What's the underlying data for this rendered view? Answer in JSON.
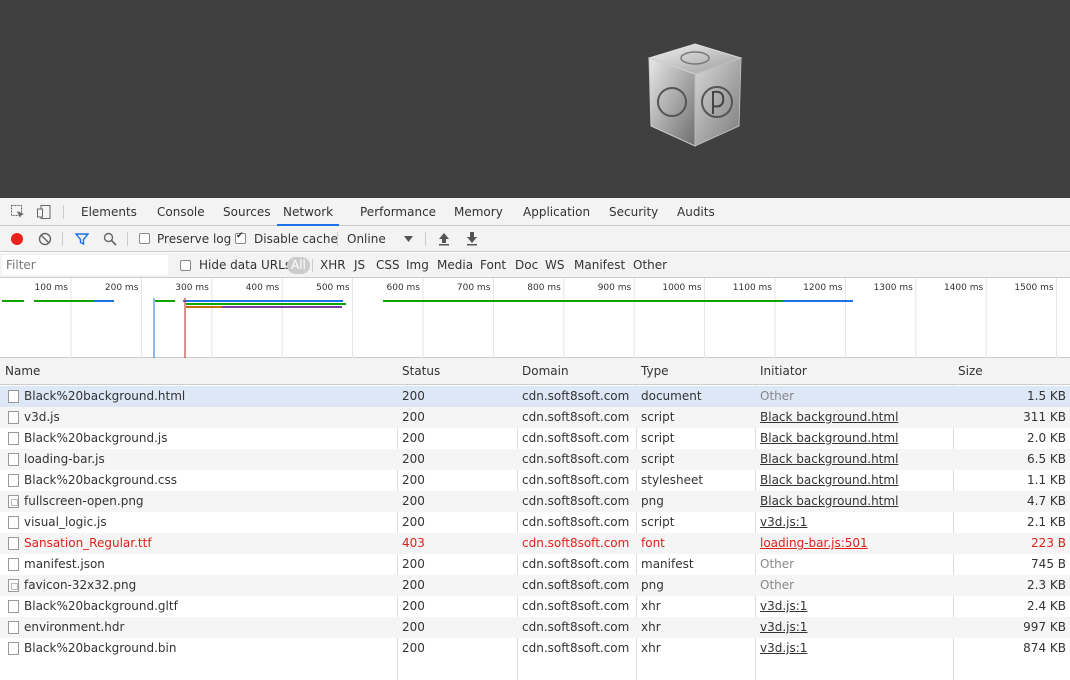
{
  "tabs": [
    "Elements",
    "Console",
    "Sources",
    "Network",
    "Performance",
    "Memory",
    "Application",
    "Security",
    "Audits"
  ],
  "active_tab": "Network",
  "toolbar": {
    "preserve_log": "Preserve log",
    "disable_cache": "Disable cache",
    "throttle": "Online"
  },
  "filterbar": {
    "placeholder": "Filter",
    "hide_data_urls": "Hide data URLs",
    "types": [
      "All",
      "XHR",
      "JS",
      "CSS",
      "Img",
      "Media",
      "Font",
      "Doc",
      "WS",
      "Manifest",
      "Other"
    ]
  },
  "overview": {
    "ticks": [
      "100 ms",
      "200 ms",
      "300 ms",
      "400 ms",
      "500 ms",
      "600 ms",
      "700 ms",
      "800 ms",
      "900 ms",
      "1000 ms",
      "1100 ms",
      "1200 ms",
      "1300 ms",
      "1400 ms",
      "1500 ms"
    ]
  },
  "columns": {
    "name": "Name",
    "status": "Status",
    "domain": "Domain",
    "type": "Type",
    "initiator": "Initiator",
    "size": "Size"
  },
  "rows": [
    {
      "name": "Black%20background.html",
      "status": "200",
      "domain": "cdn.soft8soft.com",
      "type": "document",
      "initiator": "Other",
      "size": "1.5 KB"
    },
    {
      "name": "v3d.js",
      "status": "200",
      "domain": "cdn.soft8soft.com",
      "type": "script",
      "initiator": "Black background.html",
      "size": "311 KB"
    },
    {
      "name": "Black%20background.js",
      "status": "200",
      "domain": "cdn.soft8soft.com",
      "type": "script",
      "initiator": "Black background.html",
      "size": "2.0 KB"
    },
    {
      "name": "loading-bar.js",
      "status": "200",
      "domain": "cdn.soft8soft.com",
      "type": "script",
      "initiator": "Black background.html",
      "size": "6.5 KB"
    },
    {
      "name": "Black%20background.css",
      "status": "200",
      "domain": "cdn.soft8soft.com",
      "type": "stylesheet",
      "initiator": "Black background.html",
      "size": "1.1 KB"
    },
    {
      "name": "fullscreen-open.png",
      "status": "200",
      "domain": "cdn.soft8soft.com",
      "type": "png",
      "initiator": "Black background.html",
      "size": "4.7 KB"
    },
    {
      "name": "visual_logic.js",
      "status": "200",
      "domain": "cdn.soft8soft.com",
      "type": "script",
      "initiator": "v3d.js:1",
      "size": "2.1 KB"
    },
    {
      "name": "Sansation_Regular.ttf",
      "status": "403",
      "domain": "cdn.soft8soft.com",
      "type": "font",
      "initiator": "loading-bar.js:501",
      "size": "223 B"
    },
    {
      "name": "manifest.json",
      "status": "200",
      "domain": "cdn.soft8soft.com",
      "type": "manifest",
      "initiator": "Other",
      "size": "745 B"
    },
    {
      "name": "favicon-32x32.png",
      "status": "200",
      "domain": "cdn.soft8soft.com",
      "type": "png",
      "initiator": "Other",
      "size": "2.3 KB"
    },
    {
      "name": "Black%20background.gltf",
      "status": "200",
      "domain": "cdn.soft8soft.com",
      "type": "xhr",
      "initiator": "v3d.js:1",
      "size": "2.4 KB"
    },
    {
      "name": "environment.hdr",
      "status": "200",
      "domain": "cdn.soft8soft.com",
      "type": "xhr",
      "initiator": "v3d.js:1",
      "size": "997 KB"
    },
    {
      "name": "Black%20background.bin",
      "status": "200",
      "domain": "cdn.soft8soft.com",
      "type": "xhr",
      "initiator": "v3d.js:1",
      "size": "874 KB"
    }
  ],
  "colors": {
    "viewport_bg": "#404040",
    "accent": "#1a73e8",
    "error": "#e0201b",
    "record": "#e8211b"
  }
}
